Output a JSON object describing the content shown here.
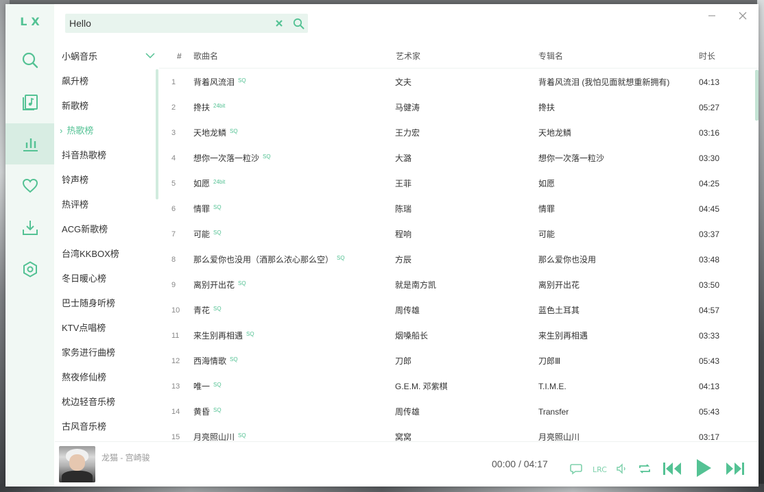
{
  "app": {
    "logo": "LX"
  },
  "search": {
    "value": "Hello"
  },
  "sidebar": {
    "items": [
      {
        "name": "search-icon"
      },
      {
        "name": "song-list-icon"
      },
      {
        "name": "chart-icon",
        "active": true
      },
      {
        "name": "heart-icon"
      },
      {
        "name": "download-icon"
      },
      {
        "name": "settings-icon"
      }
    ]
  },
  "source": {
    "selected": "小蜗音乐"
  },
  "boards": [
    "飙升榜",
    "新歌榜",
    "热歌榜",
    "抖音热歌榜",
    "铃声榜",
    "热评榜",
    "ACG新歌榜",
    "台湾KKBOX榜",
    "冬日暖心榜",
    "巴士随身听榜",
    "KTV点唱榜",
    "家务进行曲榜",
    "熬夜修仙榜",
    "枕边轻音乐榜",
    "古风音乐榜"
  ],
  "active_board_marker": "›",
  "table": {
    "headers": {
      "num": "#",
      "name": "歌曲名",
      "artist": "艺术家",
      "album": "专辑名",
      "time": "时长"
    },
    "rows": [
      {
        "num": "1",
        "name": "背着风流泪",
        "quality": "SQ",
        "artist": "文夫",
        "album": "背着风流泪 (我怕见面就想重新拥有)",
        "time": "04:13"
      },
      {
        "num": "2",
        "name": "搀扶",
        "quality": "24bit",
        "artist": "马健涛",
        "album": "搀扶",
        "time": "05:27"
      },
      {
        "num": "3",
        "name": "天地龙鳞",
        "quality": "SQ",
        "artist": "王力宏",
        "album": "天地龙鳞",
        "time": "03:16"
      },
      {
        "num": "4",
        "name": "想你一次落一粒沙",
        "quality": "SQ",
        "artist": "大潞",
        "album": "想你一次落一粒沙",
        "time": "03:30"
      },
      {
        "num": "5",
        "name": "如愿",
        "quality": "24bit",
        "artist": "王菲",
        "album": "如愿",
        "time": "04:25"
      },
      {
        "num": "6",
        "name": "情罪",
        "quality": "SQ",
        "artist": "陈瑞",
        "album": "情罪",
        "time": "04:45"
      },
      {
        "num": "7",
        "name": "可能",
        "quality": "SQ",
        "artist": "程响",
        "album": "可能",
        "time": "03:37"
      },
      {
        "num": "8",
        "name": "那么爱你也没用（酒那么浓心那么空）",
        "quality": "SQ",
        "artist": "方辰",
        "album": "那么爱你也没用",
        "time": "03:48"
      },
      {
        "num": "9",
        "name": "离别开出花",
        "quality": "SQ",
        "artist": "就是南方凯",
        "album": "离别开出花",
        "time": "03:50"
      },
      {
        "num": "10",
        "name": "青花",
        "quality": "SQ",
        "artist": "周传雄",
        "album": "蓝色土耳其",
        "time": "04:57"
      },
      {
        "num": "11",
        "name": "来生别再相遇",
        "quality": "SQ",
        "artist": "烟嗓船长",
        "album": "来生别再相遇",
        "time": "03:33"
      },
      {
        "num": "12",
        "name": "西海情歌",
        "quality": "SQ",
        "artist": "刀郎",
        "album": "刀郎Ⅲ",
        "time": "05:43"
      },
      {
        "num": "13",
        "name": "唯一",
        "quality": "SQ",
        "artist": "G.E.M. 邓紫棋",
        "album": "T.I.M.E.",
        "time": "04:13"
      },
      {
        "num": "14",
        "name": "黄昏",
        "quality": "SQ",
        "artist": "周传雄",
        "album": "Transfer",
        "time": "05:43"
      },
      {
        "num": "15",
        "name": "月亮照山川",
        "quality": "SQ",
        "artist": "窝窝",
        "album": "月亮照山川",
        "time": "03:17"
      }
    ]
  },
  "player": {
    "track": "龙猫 - 宫崎骏",
    "current": "00:00",
    "separator": "/",
    "duration": "04:17"
  },
  "colors": {
    "accent": "#54c294",
    "sidebar_bg": "#f1f8f4",
    "active_bg": "#d8ede3"
  }
}
